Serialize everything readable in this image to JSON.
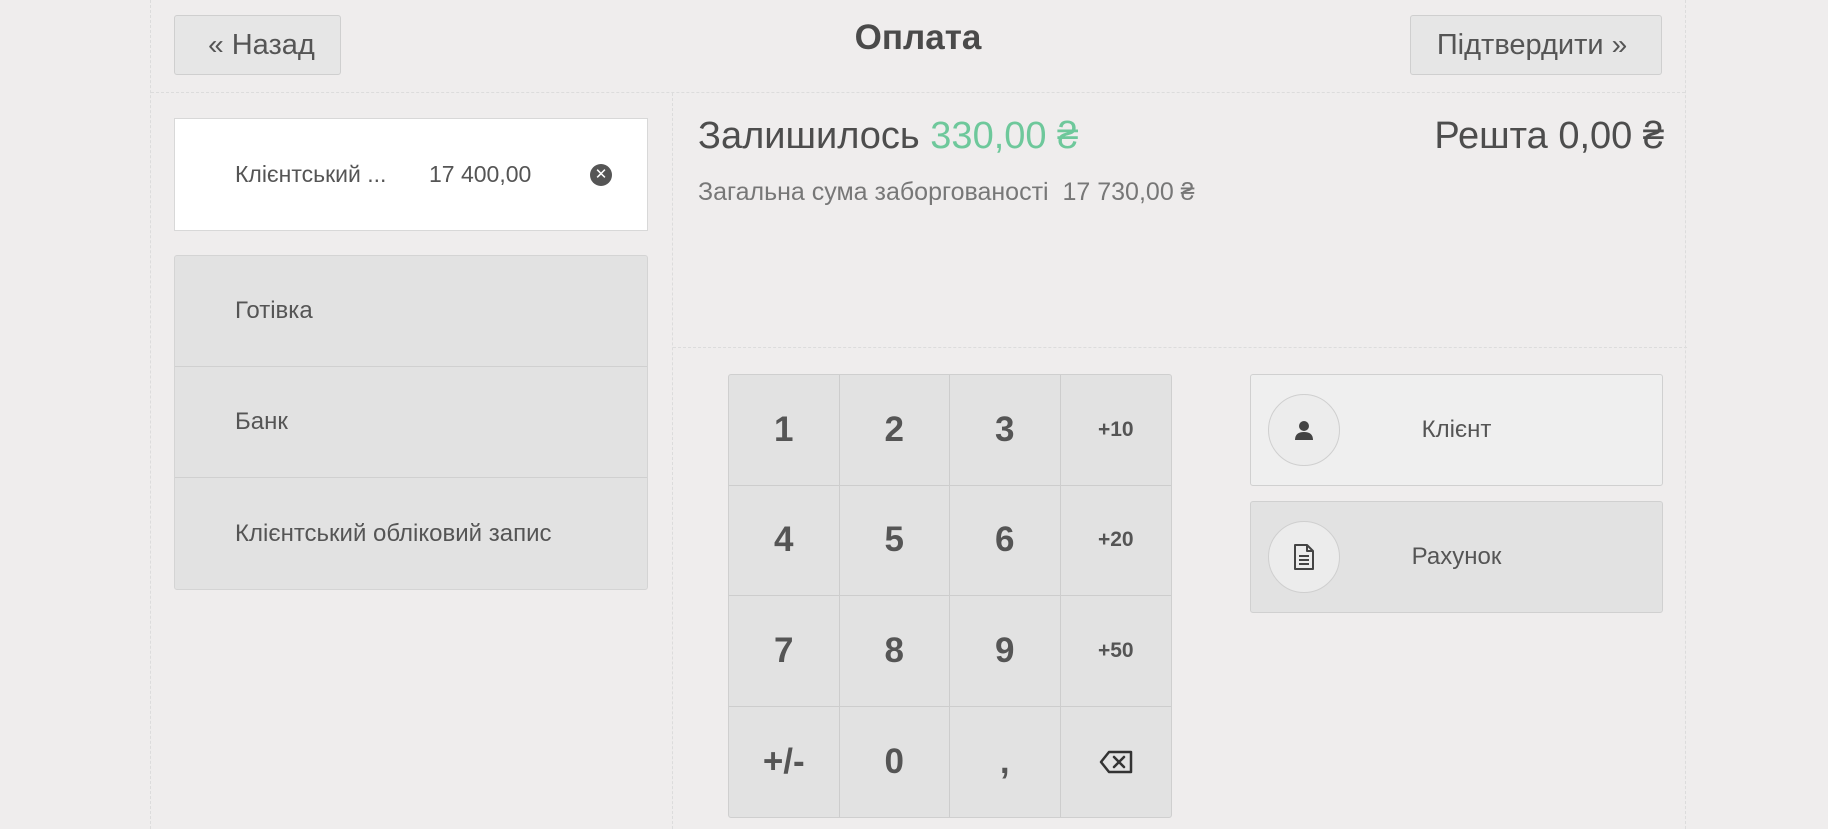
{
  "header": {
    "title": "Оплата",
    "back_label": "Назад",
    "confirm_label": "Підтвердити"
  },
  "payment_lines": [
    {
      "method": "Клієнтський ...",
      "amount": "17 400,00"
    }
  ],
  "payment_methods": [
    "Готівка",
    "Банк",
    "Клієнтський обліковий запис"
  ],
  "summary": {
    "remaining_label": "Залишилось",
    "remaining_value": "330,00 ₴",
    "change_label": "Решта",
    "change_value": "0,00 ₴",
    "debt_label": "Загальна сума заборгованості",
    "debt_value": "17 730,00 ₴"
  },
  "numpad": {
    "keys": [
      "1",
      "2",
      "3",
      "+10",
      "4",
      "5",
      "6",
      "+20",
      "7",
      "8",
      "9",
      "+50",
      "+/-",
      "0",
      ","
    ]
  },
  "actions": {
    "client_label": "Клієнт",
    "invoice_label": "Рахунок"
  },
  "colors": {
    "accent": "#6ec89b",
    "background": "#efeded"
  }
}
